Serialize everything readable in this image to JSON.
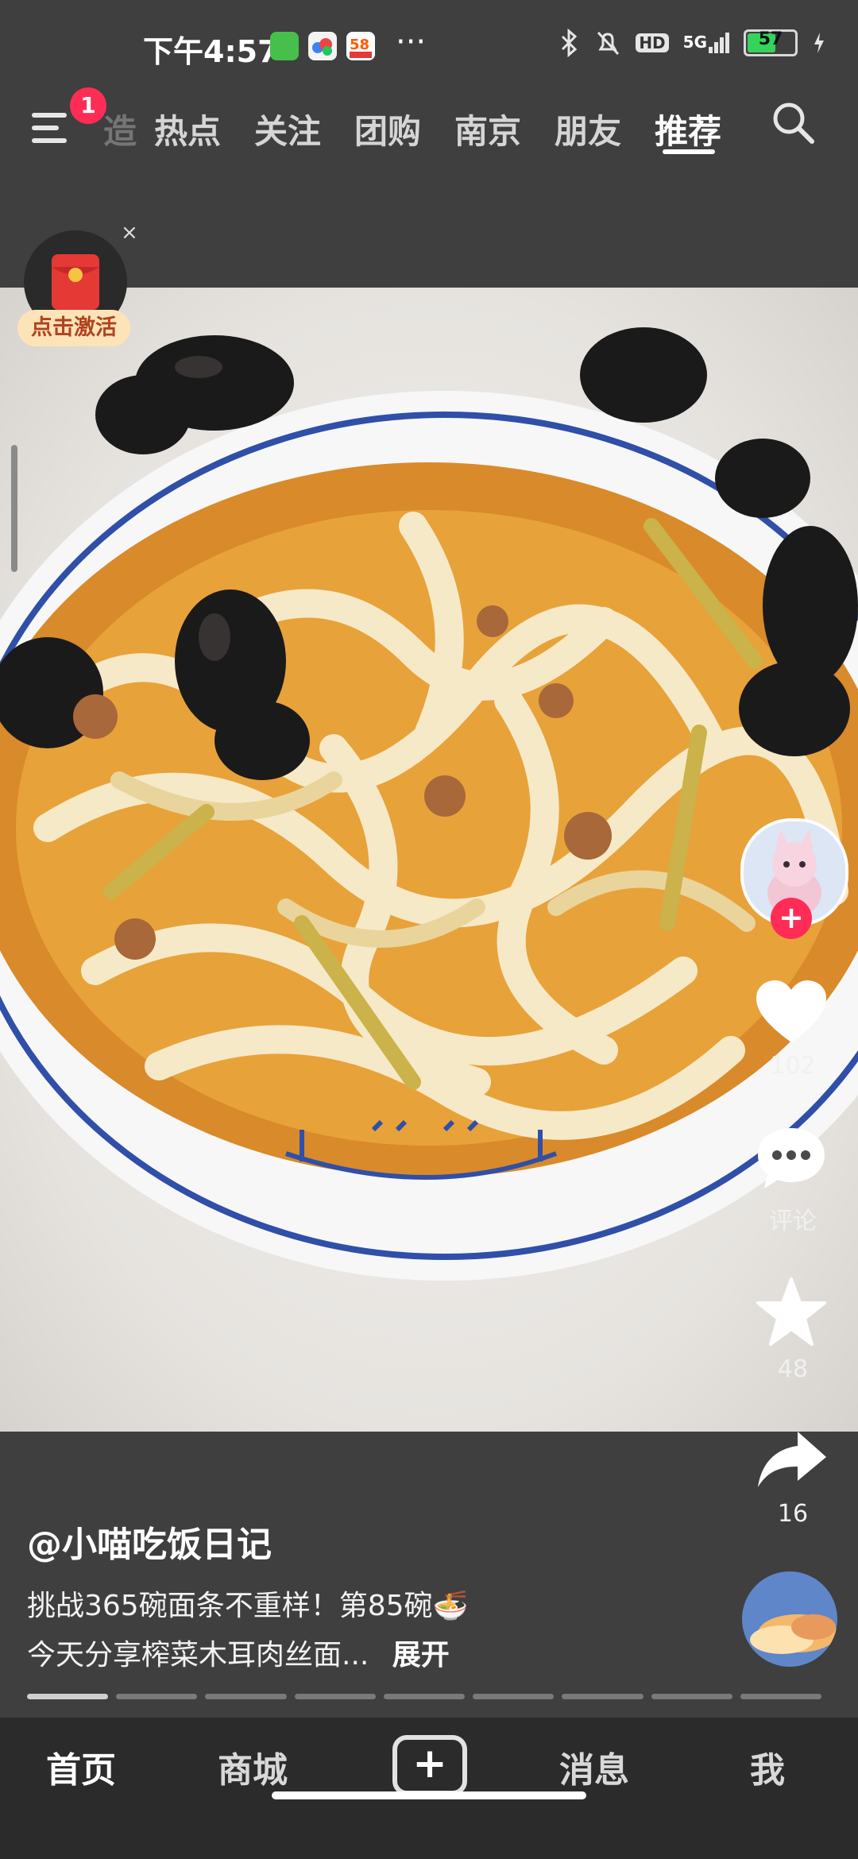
{
  "status_bar": {
    "time": "下午4:57",
    "more_dots": "···",
    "network": "5G",
    "hd": "HD",
    "battery": "57"
  },
  "top_nav": {
    "badge": "1",
    "partial_tab": "造",
    "tabs": [
      "热点",
      "关注",
      "团购",
      "南京",
      "朋友",
      "推荐"
    ],
    "active_tab": "推荐"
  },
  "red_packet": {
    "close": "×",
    "label": "点击激活"
  },
  "actions": {
    "likes": "102",
    "comments": "评论",
    "favorites": "48",
    "shares": "16",
    "follow_plus": "+"
  },
  "caption": {
    "author": "@小喵吃饭日记",
    "line1": "挑战365碗面条不重样！第85碗🍜",
    "line2": "今天分享榨菜木耳肉丝面...",
    "expand": "展开"
  },
  "progress": {
    "segments": 9,
    "active_index": 0
  },
  "bottom_nav": {
    "home": "首页",
    "mall": "商城",
    "add": "+",
    "messages": "消息",
    "me": "我",
    "active": "首页"
  }
}
